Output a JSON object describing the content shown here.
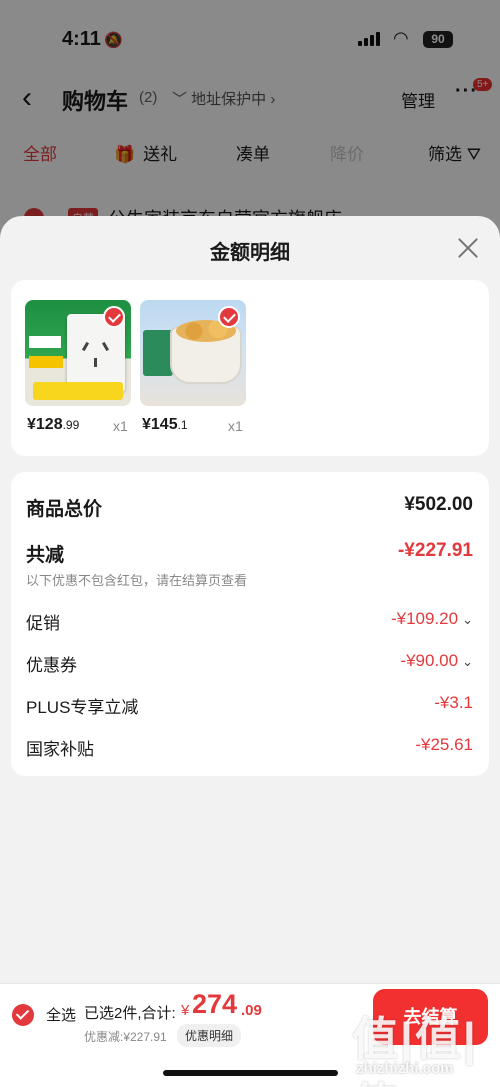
{
  "status_bar": {
    "time": "4:11",
    "battery": "90"
  },
  "nav": {
    "back_icon": "‹",
    "title": "购物车",
    "count": "(2)",
    "address_protect": "地址保护中",
    "manage": "管理",
    "more_badge": "5+"
  },
  "tabs": {
    "all": "全部",
    "gift": "送礼",
    "combo": "凑单",
    "price_drop": "降价",
    "filter": "筛选"
  },
  "shop": {
    "tag": "自营",
    "name": "公牛家装京东自营官方旗舰店 ›"
  },
  "sheet": {
    "title": "金额明细",
    "products": [
      {
        "price_int": "¥128",
        "price_dec": ".99",
        "qty": "x1"
      },
      {
        "price_int": "¥145",
        "price_dec": ".1",
        "qty": "x1"
      }
    ],
    "detail": {
      "total_label": "商品总价",
      "total_value": "¥502.00",
      "reduce_label": "共减",
      "reduce_value": "-¥227.91",
      "note": "以下优惠不包含红包，请在结算页查看",
      "promo_label": "促销",
      "promo_value": "-¥109.20",
      "coupon_label": "优惠券",
      "coupon_value": "-¥90.00",
      "plus_label": "PLUS专享立减",
      "plus_value": "-¥3.1",
      "subsidy_label": "国家补贴",
      "subsidy_value": "-¥25.61"
    }
  },
  "bottom": {
    "select_all": "全选",
    "selected": "已选2件,合计:",
    "currency": "¥",
    "total_int": "274",
    "total_dec": ".09",
    "discount": "优惠减:¥227.91",
    "detail_link": "优惠明细",
    "checkout": "去结算"
  },
  "watermark": {
    "main": "值|值|值",
    "sub": "zhizhizhi.com"
  },
  "colors": {
    "accent": "#e4393c",
    "checkout": "#f23030",
    "sheet_bg": "#f2f2f2"
  }
}
